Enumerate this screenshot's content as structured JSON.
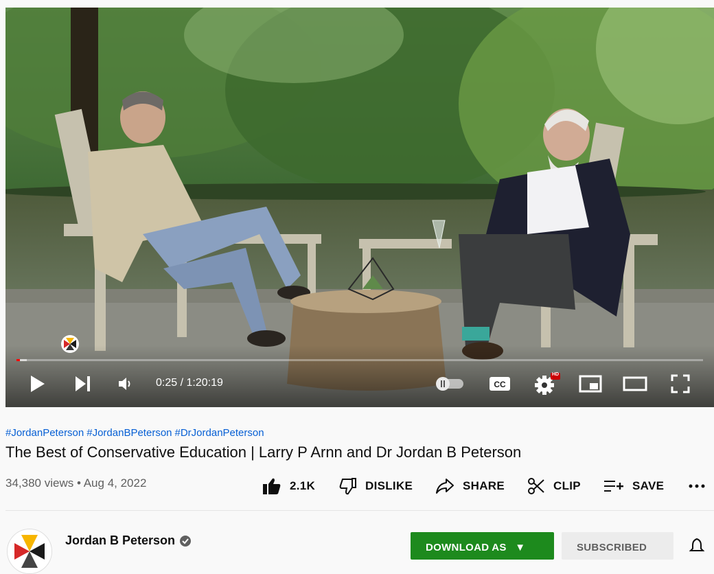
{
  "player": {
    "current_time": "0:25",
    "duration": "1:20:19",
    "time_display": "0:25 / 1:20:19",
    "progress_fraction": 0.0052,
    "buffered_fraction": 0.015,
    "hd_badge": "HD",
    "autoplay_state": "off",
    "accent_color": "#ff0000"
  },
  "video": {
    "hashtags": [
      "#JordanPeterson",
      "#JordanBPeterson",
      "#DrJordanPeterson"
    ],
    "title": "The Best of Conservative Education | Larry P Arnn and Dr Jordan B Peterson",
    "views": "34,380 views",
    "separator": "•",
    "date": "Aug 4, 2022"
  },
  "actions": {
    "like_count": "2.1K",
    "dislike_label": "DISLIKE",
    "share_label": "SHARE",
    "clip_label": "CLIP",
    "save_label": "SAVE"
  },
  "channel": {
    "name": "Jordan B Peterson",
    "download_label": "DOWNLOAD AS",
    "subscribed_label": "SUBSCRIBED",
    "download_color": "#1d8a1d"
  },
  "icons": [
    "play-icon",
    "next-icon",
    "volume-icon",
    "autoplay-toggle-icon",
    "captions-icon",
    "settings-icon",
    "miniplayer-icon",
    "theater-icon",
    "fullscreen-icon",
    "like-icon",
    "dislike-icon",
    "share-icon",
    "clip-icon",
    "save-icon",
    "more-icon",
    "verified-icon",
    "bell-icon"
  ]
}
